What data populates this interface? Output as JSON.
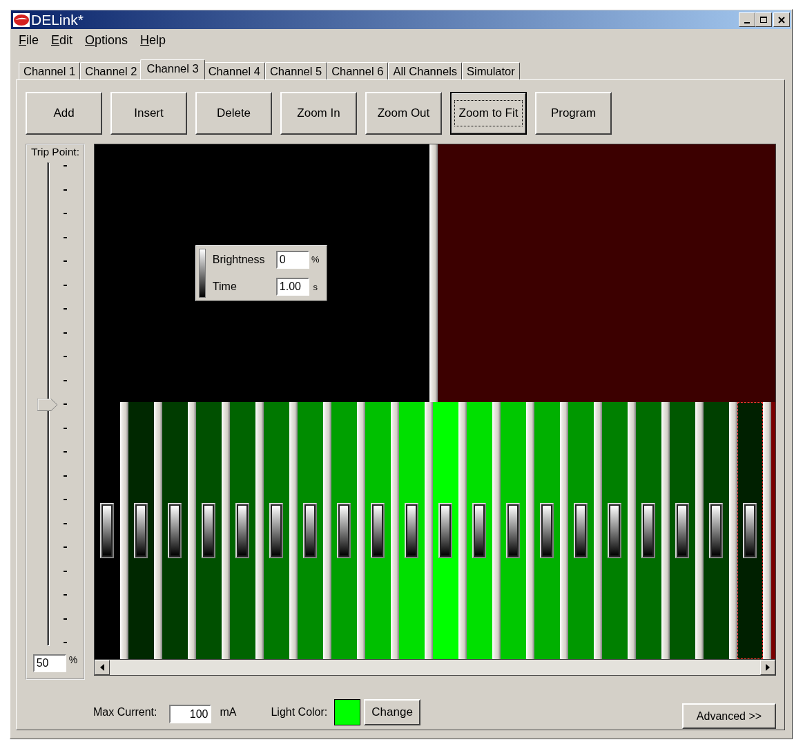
{
  "window": {
    "title": "DELink*"
  },
  "menu": [
    {
      "label": "File"
    },
    {
      "label": "Edit"
    },
    {
      "label": "Options"
    },
    {
      "label": "Help"
    }
  ],
  "tabs": [
    {
      "label": "Channel 1",
      "selected": false
    },
    {
      "label": "Channel 2",
      "selected": false
    },
    {
      "label": "Channel 3",
      "selected": true
    },
    {
      "label": "Channel 4",
      "selected": false
    },
    {
      "label": "Channel 5",
      "selected": false
    },
    {
      "label": "Channel 6",
      "selected": false
    },
    {
      "label": "All Channels",
      "selected": false
    },
    {
      "label": "Simulator",
      "selected": false
    }
  ],
  "toolbar": [
    {
      "label": "Add",
      "focused": false
    },
    {
      "label": "Insert",
      "focused": false
    },
    {
      "label": "Delete",
      "focused": false
    },
    {
      "label": "Zoom In",
      "focused": false
    },
    {
      "label": "Zoom Out",
      "focused": false
    },
    {
      "label": "Zoom to Fit",
      "focused": true
    },
    {
      "label": "Program",
      "focused": false
    }
  ],
  "trip_point": {
    "label": "Trip Point:",
    "level": 0.5,
    "value": "50",
    "unit": "%"
  },
  "timeline": {
    "steps": [
      {
        "color": "#000000",
        "selected": false
      },
      {
        "color": "#002800",
        "selected": false
      },
      {
        "color": "#003c00",
        "selected": false
      },
      {
        "color": "#005000",
        "selected": false
      },
      {
        "color": "#006400",
        "selected": false
      },
      {
        "color": "#007800",
        "selected": false
      },
      {
        "color": "#008c00",
        "selected": false
      },
      {
        "color": "#00a000",
        "selected": false
      },
      {
        "color": "#00c000",
        "selected": false
      },
      {
        "color": "#00e000",
        "selected": false
      },
      {
        "color": "#00ff00",
        "selected": false
      },
      {
        "color": "#00e000",
        "selected": false
      },
      {
        "color": "#00c800",
        "selected": false
      },
      {
        "color": "#00b000",
        "selected": false
      },
      {
        "color": "#009800",
        "selected": false
      },
      {
        "color": "#008000",
        "selected": false
      },
      {
        "color": "#006c00",
        "selected": false
      },
      {
        "color": "#005800",
        "selected": false
      },
      {
        "color": "#004000",
        "selected": false
      },
      {
        "color": "#002000",
        "selected": true
      }
    ],
    "popup": {
      "brightness_label": "Brightness",
      "brightness_value": "0",
      "brightness_unit": "%",
      "time_label": "Time",
      "time_value": "1.00",
      "time_unit": "s"
    }
  },
  "footer": {
    "max_current_label": "Max Current:",
    "max_current_value": "100",
    "max_current_unit": "mA",
    "light_color_label": "Light Color:",
    "light_color": {
      "color": "#00ff00"
    },
    "change_button": "Change",
    "advanced_button": "Advanced >>"
  }
}
